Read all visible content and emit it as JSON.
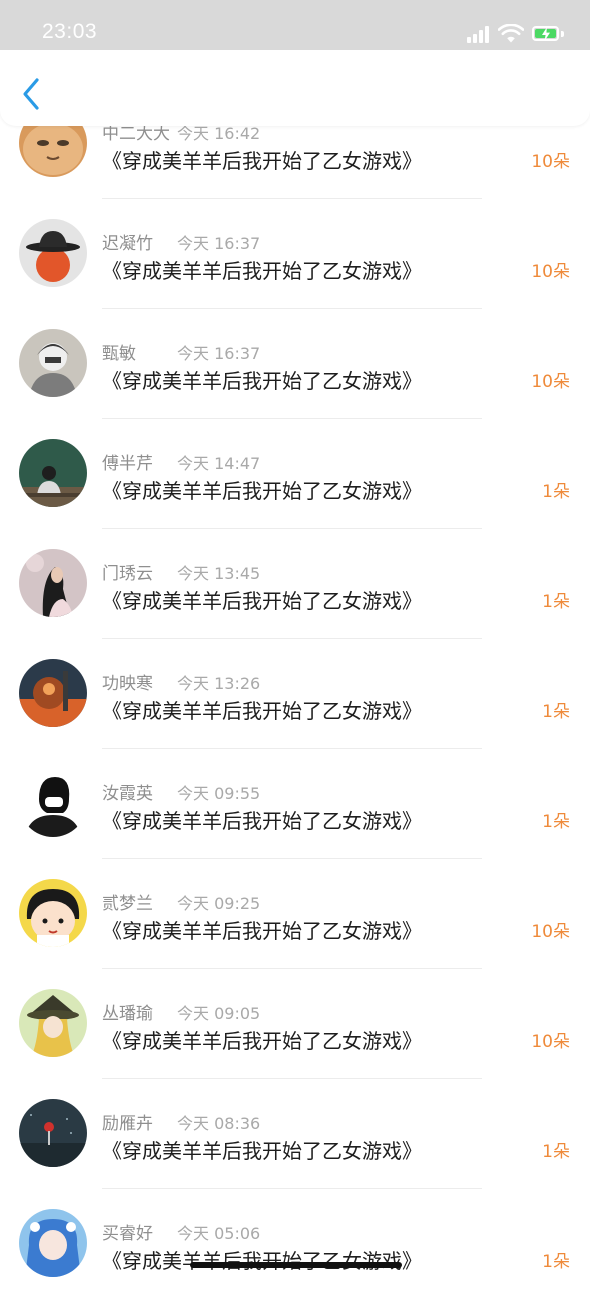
{
  "status_bar": {
    "time": "23:03"
  },
  "nav": {
    "back_icon": "chevron-left-icon"
  },
  "colors": {
    "amount": "#ef8a3a",
    "back_arrow": "#2a9be6",
    "battery_fill": "#4cd964"
  },
  "rows": [
    {
      "name": "中二大大",
      "time": "今天 16:42",
      "title": "《穿成美羊羊后我开始了乙女游戏》",
      "amount": "10朵"
    },
    {
      "name": "迟凝竹",
      "time": "今天 16:37",
      "title": "《穿成美羊羊后我开始了乙女游戏》",
      "amount": "10朵"
    },
    {
      "name": "甄敏",
      "time": "今天 16:37",
      "title": "《穿成美羊羊后我开始了乙女游戏》",
      "amount": "10朵"
    },
    {
      "name": "傅半芹",
      "time": "今天 14:47",
      "title": "《穿成美羊羊后我开始了乙女游戏》",
      "amount": "1朵"
    },
    {
      "name": "门琇云",
      "time": "今天 13:45",
      "title": "《穿成美羊羊后我开始了乙女游戏》",
      "amount": "1朵"
    },
    {
      "name": "功映寒",
      "time": "今天 13:26",
      "title": "《穿成美羊羊后我开始了乙女游戏》",
      "amount": "1朵"
    },
    {
      "name": "汝霞英",
      "time": "今天 09:55",
      "title": "《穿成美羊羊后我开始了乙女游戏》",
      "amount": "1朵"
    },
    {
      "name": "贰梦兰",
      "time": "今天 09:25",
      "title": "《穿成美羊羊后我开始了乙女游戏》",
      "amount": "10朵"
    },
    {
      "name": "丛璠瑜",
      "time": "今天 09:05",
      "title": "《穿成美羊羊后我开始了乙女游戏》",
      "amount": "10朵"
    },
    {
      "name": "励雁卉",
      "time": "今天 08:36",
      "title": "《穿成美羊羊后我开始了乙女游戏》",
      "amount": "1朵"
    },
    {
      "name": "买睿好",
      "time": "今天 05:06",
      "title": "《穿成美羊羊后我开始了乙女游戏》",
      "amount": "1朵"
    }
  ]
}
